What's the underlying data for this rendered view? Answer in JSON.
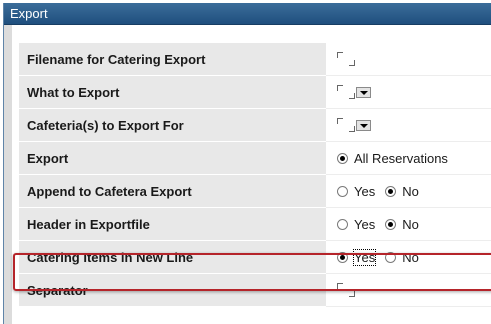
{
  "panel": {
    "title": "Export"
  },
  "rows": [
    {
      "label": "Filename for Catering Export"
    },
    {
      "label": "What to Export"
    },
    {
      "label": "Cafeteria(s) to Export For"
    },
    {
      "label": "Export",
      "option": "All Reservations"
    },
    {
      "label": "Append to Cafetera Export",
      "yes": "Yes",
      "no": "No"
    },
    {
      "label": "Header in Exportfile",
      "yes": "Yes",
      "no": "No"
    },
    {
      "label": "Catering Items in New Line",
      "yes": "Yes",
      "no": "No"
    },
    {
      "label": "Separator"
    }
  ],
  "highlight_color": "#b5242a"
}
